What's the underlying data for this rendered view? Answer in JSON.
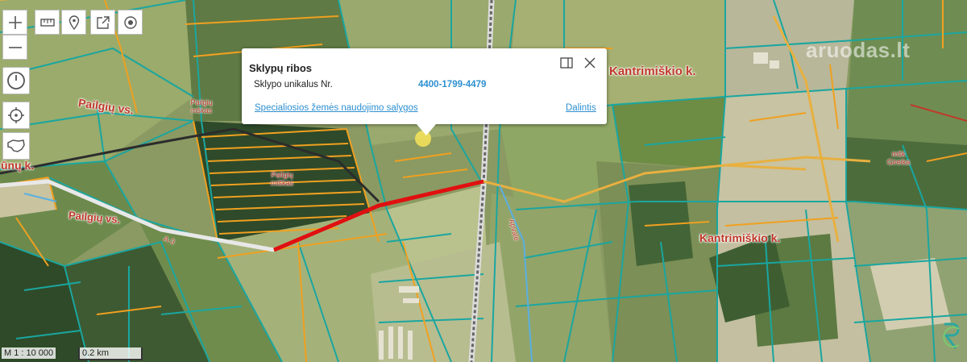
{
  "popup": {
    "title": "Sklypų ribos",
    "field_label": "Sklypo unikalus Nr.",
    "field_value": "4400-1799-4479",
    "link_conditions": "Specialiosios žemės naudojimo salygos",
    "link_share": "Dalintis"
  },
  "scale": {
    "ratio": "M 1 : 10 000",
    "distance": "0.2 km"
  },
  "map_labels": {
    "village_east": "Kantrimiškio k.",
    "village_east_top": "Kantrimiškio k.",
    "village_west": "Pailgių vs.",
    "village_west_top": "Pailgių vs.",
    "village_cut": "ūnų k.",
    "forest_1": "Pailgių\nmškas",
    "forest_2": "Pailgių\nmiškas",
    "forest_3": "mšk\nGireika",
    "road_a3": "A-3",
    "river": "Apvalė"
  },
  "watermark": "aruodas.lt",
  "colors": {
    "parcel_teal": "#1aa6a0",
    "parcel_orange": "#f0a020",
    "highlight_road": "#e01010",
    "link_blue": "#2d8fd0"
  }
}
